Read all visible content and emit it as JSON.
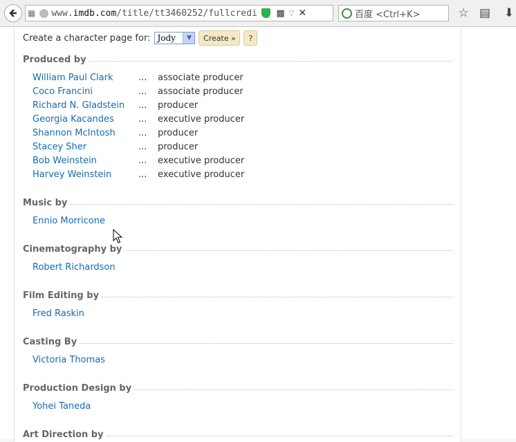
{
  "browser": {
    "url_prefix": "www.",
    "url_domain": "imdb.com",
    "url_path": "/title/tt3460252/fullcredi",
    "search_placeholder": "百度 <Ctrl+K>"
  },
  "character_page": {
    "label": "Create a character page for:",
    "selected_character": "Jody",
    "create_label": "Create »",
    "help_label": "?"
  },
  "sections": {
    "produced": {
      "title": "Produced by",
      "rows": [
        {
          "name": "William Paul Clark",
          "dots": "...",
          "role": "associate producer"
        },
        {
          "name": "Coco Francini",
          "dots": "...",
          "role": "associate producer"
        },
        {
          "name": "Richard N. Gladstein",
          "dots": "...",
          "role": "producer"
        },
        {
          "name": "Georgia Kacandes",
          "dots": "...",
          "role": "executive producer"
        },
        {
          "name": "Shannon McIntosh",
          "dots": "...",
          "role": "producer"
        },
        {
          "name": "Stacey Sher",
          "dots": "...",
          "role": "producer"
        },
        {
          "name": "Bob Weinstein",
          "dots": "...",
          "role": "executive producer"
        },
        {
          "name": "Harvey Weinstein",
          "dots": "...",
          "role": "executive producer"
        }
      ]
    },
    "music": {
      "title": "Music by",
      "rows": [
        {
          "name": "Ennio Morricone"
        }
      ]
    },
    "cinematography": {
      "title": "Cinematography by",
      "rows": [
        {
          "name": "Robert Richardson"
        }
      ]
    },
    "editing": {
      "title": "Film Editing by",
      "rows": [
        {
          "name": "Fred Raskin"
        }
      ]
    },
    "casting": {
      "title": "Casting By",
      "rows": [
        {
          "name": "Victoria Thomas"
        }
      ]
    },
    "design": {
      "title": "Production Design by",
      "rows": [
        {
          "name": "Yohei Taneda"
        }
      ]
    },
    "art": {
      "title": "Art Direction by"
    }
  }
}
